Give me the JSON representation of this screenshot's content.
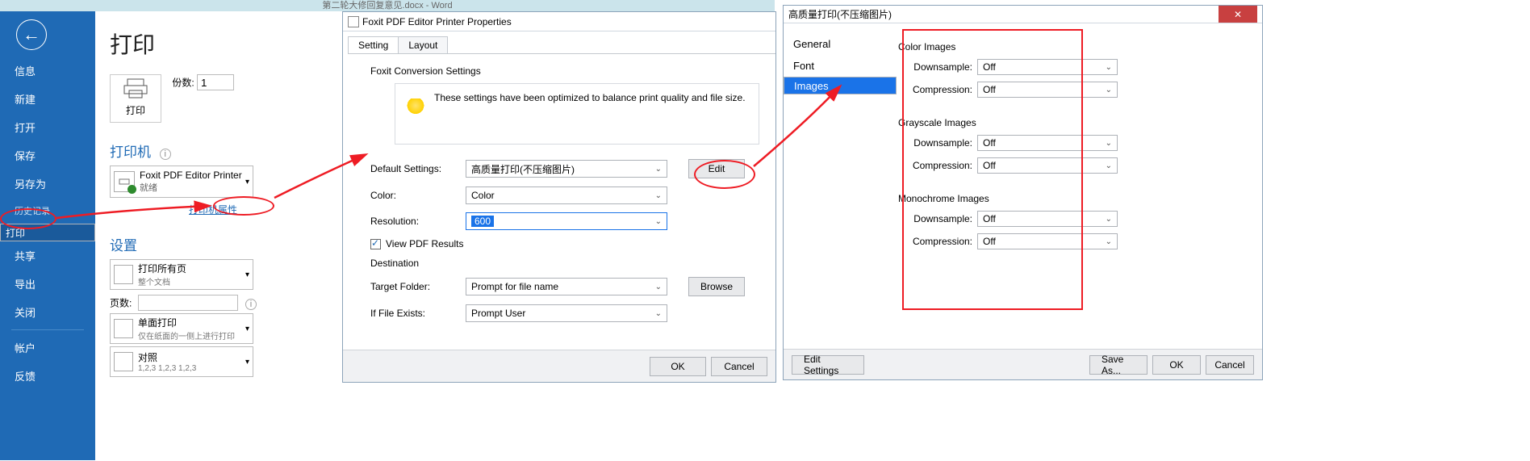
{
  "word": {
    "doc_title": "第二轮大修回复意见.docx  -  Word",
    "nav": {
      "info": "信息",
      "new": "新建",
      "open": "打开",
      "save": "保存",
      "saveas": "另存为",
      "history": "历史记录",
      "print": "打印",
      "share": "共享",
      "export": "导出",
      "close": "关闭",
      "account": "帐户",
      "feedback": "反馈"
    },
    "print": {
      "title": "打印",
      "big_button": "打印",
      "copies_label": "份数:",
      "copies_value": "1",
      "printer_section": "打印机",
      "printer_name": "Foxit PDF Editor Printer",
      "printer_status": "就绪",
      "printer_props": "打印机属性",
      "settings_section": "设置",
      "setting_print_all": {
        "t": "打印所有页",
        "s": "整个文档"
      },
      "pages_label": "页数:",
      "setting_onesided": {
        "t": "单面打印",
        "s": "仅在纸面的一侧上进行打印"
      },
      "setting_collate": {
        "t": "对照",
        "s": "1,2,3    1,2,3    1,2,3"
      }
    }
  },
  "foxit": {
    "title": "Foxit PDF Editor Printer Properties",
    "tabs": {
      "setting": "Setting",
      "layout": "Layout"
    },
    "heading": "Foxit Conversion Settings",
    "hint": "These settings have been optimized to balance print quality and file size.",
    "fields": {
      "default_label": "Default Settings:",
      "default_value": "高质量打印(不压缩图片)",
      "edit": "Edit",
      "color_label": "Color:",
      "color_value": "Color",
      "res_label": "Resolution:",
      "res_value": "600",
      "view_pdf": "View PDF Results",
      "destination": "Destination",
      "target_label": "Target Folder:",
      "target_value": "Prompt for file name",
      "browse": "Browse",
      "exists_label": "If File Exists:",
      "exists_value": "Prompt User"
    },
    "ok": "OK",
    "cancel": "Cancel"
  },
  "hq": {
    "title": "高质量打印(不压缩图片)",
    "nav": {
      "general": "General",
      "font": "Font",
      "images": "Images"
    },
    "groups": {
      "color": "Color Images",
      "gray": "Grayscale Images",
      "mono": "Monochrome Images"
    },
    "labels": {
      "down": "Downsample:",
      "comp": "Compression:"
    },
    "off": "Off",
    "edit_settings": "Edit Settings",
    "saveas": "Save As...",
    "ok": "OK",
    "cancel": "Cancel"
  }
}
